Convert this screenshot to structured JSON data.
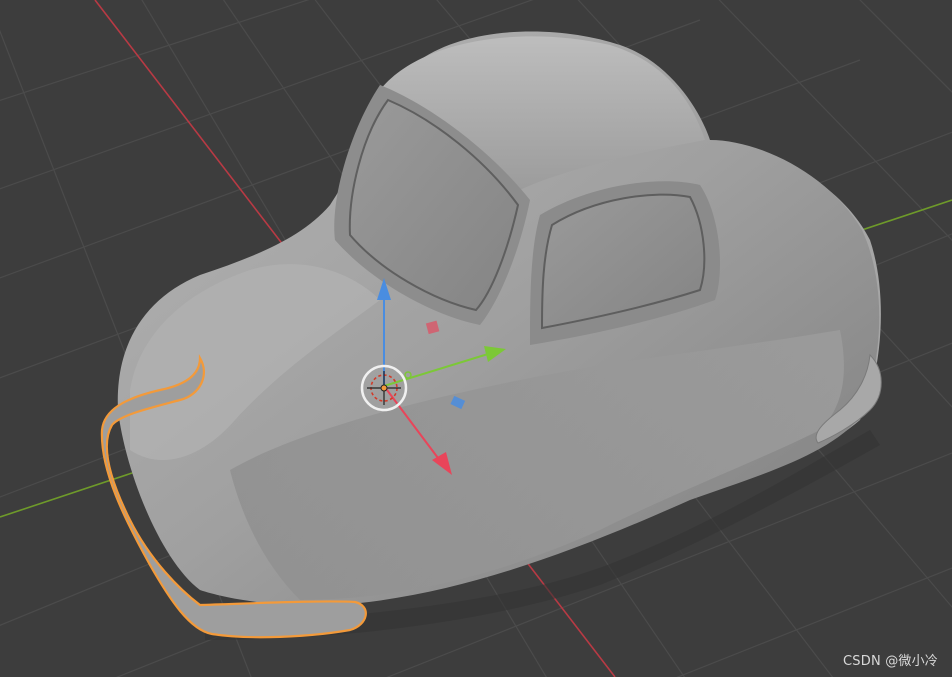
{
  "watermark": "CSDN @微小冷",
  "viewport": {
    "background": "#3d3d3d",
    "grid_color": "#4a4a4a",
    "x_axis_color": "#b83a44",
    "y_axis_color": "#6e9a2a"
  },
  "model": {
    "body_color": "#a3a3a3",
    "selection_outline_color": "#f39a3a"
  },
  "gizmo": {
    "x_color": "#e8455a",
    "y_color": "#7cc837",
    "z_color": "#4a8de0"
  }
}
